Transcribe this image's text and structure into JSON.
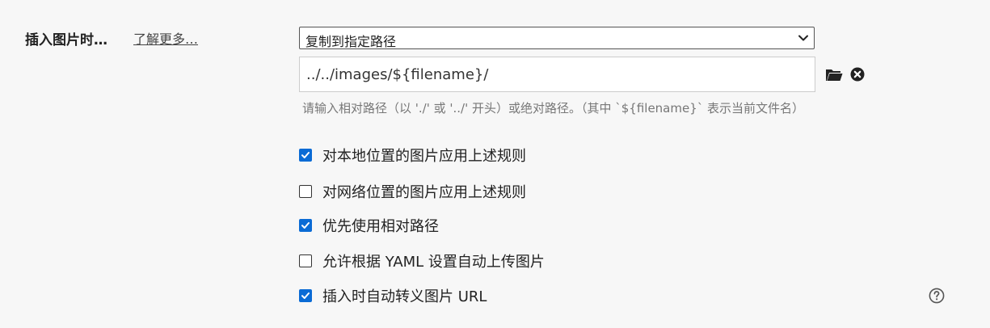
{
  "section": {
    "label": "插入图片时…",
    "learn_more": "了解更多…"
  },
  "select": {
    "value": "复制到指定路径",
    "icon": "chevron-down-icon"
  },
  "path_input": {
    "value": "../../images/${filename}/"
  },
  "icons": {
    "folder": "folder-icon",
    "clear": "close-circle-icon",
    "help": "question-circle-icon"
  },
  "hint": "请输入相对路径（以 './' 或 '../' 开头）或绝对路径。（其中 `${filename}` 表示当前文件名）",
  "options": [
    {
      "label": "对本地位置的图片应用上述规则",
      "checked": true
    },
    {
      "label": "对网络位置的图片应用上述规则",
      "checked": false
    },
    {
      "label": "优先使用相对路径",
      "checked": true
    },
    {
      "label": "允许根据 YAML 设置自动上传图片",
      "checked": false
    },
    {
      "label": "插入时自动转义图片 URL",
      "checked": true
    }
  ],
  "colors": {
    "checkbox_checked": "#0a6bd5",
    "background": "#f7f7f7"
  }
}
